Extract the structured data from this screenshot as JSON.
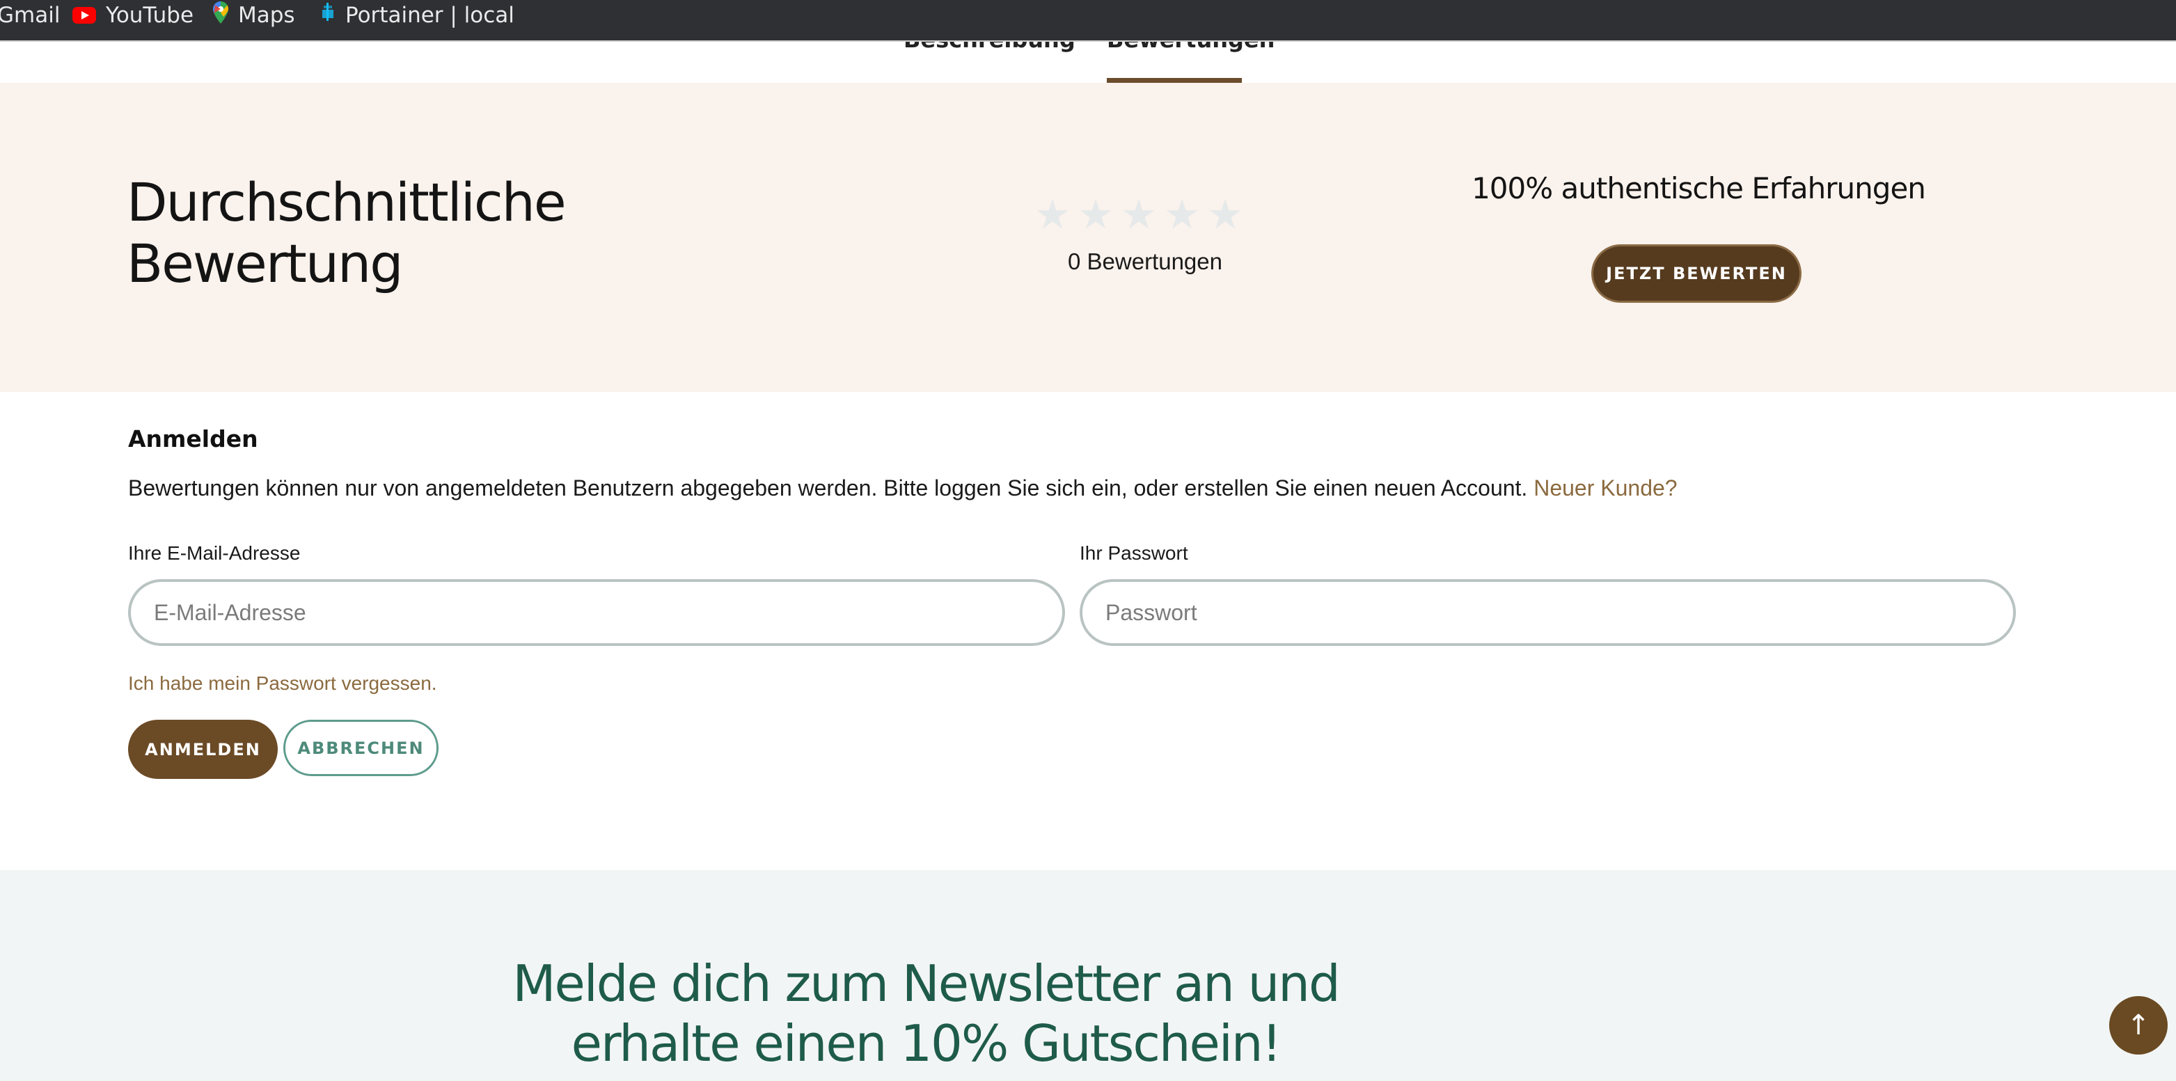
{
  "bookmarks": [
    {
      "label": "Gmail",
      "icon": "gmail-icon"
    },
    {
      "label": "YouTube",
      "icon": "youtube-icon"
    },
    {
      "label": "Maps",
      "icon": "maps-pin-icon"
    },
    {
      "label": "Portainer | local",
      "icon": "portainer-icon"
    }
  ],
  "tabs": [
    {
      "label": "Beschreibung"
    },
    {
      "label": "Bewertungen",
      "active": true
    }
  ],
  "rating": {
    "title": "Durchschnittliche Bewertung",
    "stars_filled": 0,
    "stars_total": 5,
    "count_text": "0 Bewertungen",
    "authentic_text": "100% authentische Erfahrungen",
    "rate_button": "JETZT BEWERTEN"
  },
  "login": {
    "heading": "Anmelden",
    "info_text": "Bewertungen können nur von angemeldeten Benutzern abgegeben werden. Bitte loggen Sie sich ein, oder erstellen Sie einen neuen Account.",
    "new_customer_link": "Neuer Kunde?",
    "email_label": "Ihre E-Mail-Adresse",
    "email_placeholder": "E-Mail-Adresse",
    "password_label": "Ihr Passwort",
    "password_placeholder": "Passwort",
    "forgot_link": "Ich habe mein Passwort vergessen.",
    "login_button": "ANMELDEN",
    "cancel_button": "ABBRECHEN"
  },
  "newsletter": {
    "title": "Melde dich zum Newsletter an und erhalte einen 10% Gutschein!"
  },
  "scroll_top": {
    "icon": "arrow-up-icon",
    "glyph": "↑"
  },
  "colors": {
    "brand_brown": "#6b4a26",
    "link_brown": "#8b6a3f",
    "teal": "#1e5b4a",
    "rating_bg": "#faf2ec"
  }
}
